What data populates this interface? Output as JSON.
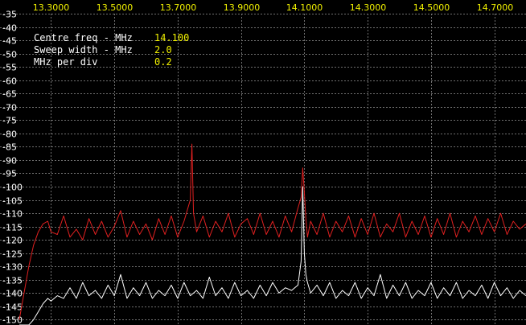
{
  "info": {
    "centre_label": "Centre freq - MHz",
    "centre_value": "14.100",
    "sweep_label": "Sweep width - MHz",
    "sweep_value": "2.0",
    "div_label": "MHz per div",
    "div_value": "0.2"
  },
  "colors": {
    "background": "#000000",
    "grid": "#707070",
    "x_tick_text": "#f2f200",
    "y_tick_text": "#ffffff",
    "info_value_text": "#f2f200",
    "trace_red": "#e02020",
    "trace_white": "#ffffff"
  },
  "chart_data": {
    "type": "line",
    "xlim": [
      13.2,
      14.8
    ],
    "ylim": [
      -152,
      -35
    ],
    "x_ticks": [
      "13.3000",
      "13.5000",
      "13.7000",
      "13.9000",
      "14.1000",
      "14.3000",
      "14.5000",
      "14.7000"
    ],
    "x_tick_values": [
      13.3,
      13.5,
      13.7,
      13.9,
      14.1,
      14.3,
      14.5,
      14.7
    ],
    "y_ticks": [
      "-35",
      "-40",
      "-45",
      "-50",
      "-55",
      "-60",
      "-65",
      "-70",
      "-75",
      "-80",
      "-85",
      "-90",
      "-95",
      "-100",
      "-105",
      "-110",
      "-115",
      "-120",
      "-125",
      "-130",
      "-135",
      "-140",
      "-145",
      "-150"
    ],
    "y_tick_values": [
      -35,
      -40,
      -45,
      -50,
      -55,
      -60,
      -65,
      -70,
      -75,
      -80,
      -85,
      -90,
      -95,
      -100,
      -105,
      -110,
      -115,
      -120,
      -125,
      -130,
      -135,
      -140,
      -145,
      -150
    ],
    "grid": true,
    "series": [
      {
        "color": "#e02020",
        "x": [
          13.2,
          13.215,
          13.23,
          13.245,
          13.26,
          13.275,
          13.29,
          13.3,
          13.32,
          13.34,
          13.36,
          13.38,
          13.4,
          13.42,
          13.44,
          13.46,
          13.48,
          13.5,
          13.52,
          13.54,
          13.56,
          13.58,
          13.6,
          13.62,
          13.64,
          13.66,
          13.68,
          13.7,
          13.72,
          13.74,
          13.745,
          13.75,
          13.76,
          13.78,
          13.8,
          13.82,
          13.84,
          13.86,
          13.88,
          13.9,
          13.92,
          13.94,
          13.96,
          13.98,
          14.0,
          14.02,
          14.04,
          14.06,
          14.08,
          14.09,
          14.095,
          14.1,
          14.105,
          14.11,
          14.12,
          14.14,
          14.16,
          14.18,
          14.2,
          14.22,
          14.24,
          14.26,
          14.28,
          14.3,
          14.32,
          14.34,
          14.36,
          14.38,
          14.4,
          14.42,
          14.44,
          14.46,
          14.48,
          14.5,
          14.52,
          14.54,
          14.56,
          14.58,
          14.6,
          14.62,
          14.64,
          14.66,
          14.68,
          14.7,
          14.72,
          14.74,
          14.76,
          14.78,
          14.8
        ],
        "y": [
          -150,
          -140,
          -130,
          -122,
          -117,
          -114,
          -113,
          -117,
          -118,
          -111,
          -119,
          -116,
          -120,
          -112,
          -118,
          -113,
          -119,
          -115,
          -109,
          -119,
          -113,
          -118,
          -114,
          -120,
          -112,
          -118,
          -111,
          -119,
          -113,
          -105,
          -84,
          -110,
          -117,
          -111,
          -119,
          -113,
          -117,
          -110,
          -119,
          -114,
          -112,
          -118,
          -110,
          -118,
          -113,
          -119,
          -111,
          -117,
          -108,
          -104,
          -93,
          -102,
          -112,
          -119,
          -113,
          -118,
          -110,
          -119,
          -113,
          -117,
          -111,
          -119,
          -112,
          -118,
          -110,
          -119,
          -114,
          -117,
          -110,
          -119,
          -113,
          -118,
          -111,
          -119,
          -112,
          -118,
          -110,
          -119,
          -113,
          -117,
          -111,
          -118,
          -112,
          -117,
          -110,
          -118,
          -113,
          -116,
          -114
        ]
      },
      {
        "color": "#ffffff",
        "x": [
          13.2,
          13.215,
          13.23,
          13.245,
          13.26,
          13.275,
          13.29,
          13.3,
          13.32,
          13.34,
          13.36,
          13.38,
          13.4,
          13.42,
          13.44,
          13.46,
          13.48,
          13.5,
          13.52,
          13.54,
          13.56,
          13.58,
          13.6,
          13.62,
          13.64,
          13.66,
          13.68,
          13.7,
          13.72,
          13.74,
          13.76,
          13.78,
          13.8,
          13.82,
          13.84,
          13.86,
          13.88,
          13.9,
          13.92,
          13.94,
          13.96,
          13.98,
          14.0,
          14.02,
          14.04,
          14.06,
          14.08,
          14.09,
          14.095,
          14.1,
          14.105,
          14.11,
          14.12,
          14.14,
          14.16,
          14.18,
          14.2,
          14.22,
          14.24,
          14.26,
          14.28,
          14.3,
          14.32,
          14.34,
          14.36,
          14.38,
          14.4,
          14.42,
          14.44,
          14.46,
          14.48,
          14.5,
          14.52,
          14.54,
          14.56,
          14.58,
          14.6,
          14.62,
          14.64,
          14.66,
          14.68,
          14.7,
          14.72,
          14.74,
          14.76,
          14.78,
          14.8
        ],
        "y": [
          -152,
          -152,
          -152,
          -150,
          -147,
          -144,
          -142,
          -143,
          -141,
          -142,
          -138,
          -142,
          -136,
          -141,
          -139,
          -142,
          -137,
          -141,
          -133,
          -142,
          -138,
          -141,
          -136,
          -142,
          -139,
          -141,
          -137,
          -142,
          -136,
          -141,
          -139,
          -142,
          -134,
          -141,
          -138,
          -142,
          -136,
          -141,
          -139,
          -142,
          -137,
          -141,
          -136,
          -140,
          -138,
          -139,
          -137,
          -128,
          -100,
          -125,
          -133,
          -136,
          -140,
          -137,
          -141,
          -136,
          -142,
          -139,
          -141,
          -136,
          -142,
          -138,
          -141,
          -133,
          -142,
          -137,
          -141,
          -136,
          -142,
          -139,
          -141,
          -136,
          -142,
          -138,
          -141,
          -136,
          -142,
          -139,
          -141,
          -137,
          -142,
          -136,
          -141,
          -138,
          -142,
          -139,
          -141
        ]
      }
    ]
  }
}
